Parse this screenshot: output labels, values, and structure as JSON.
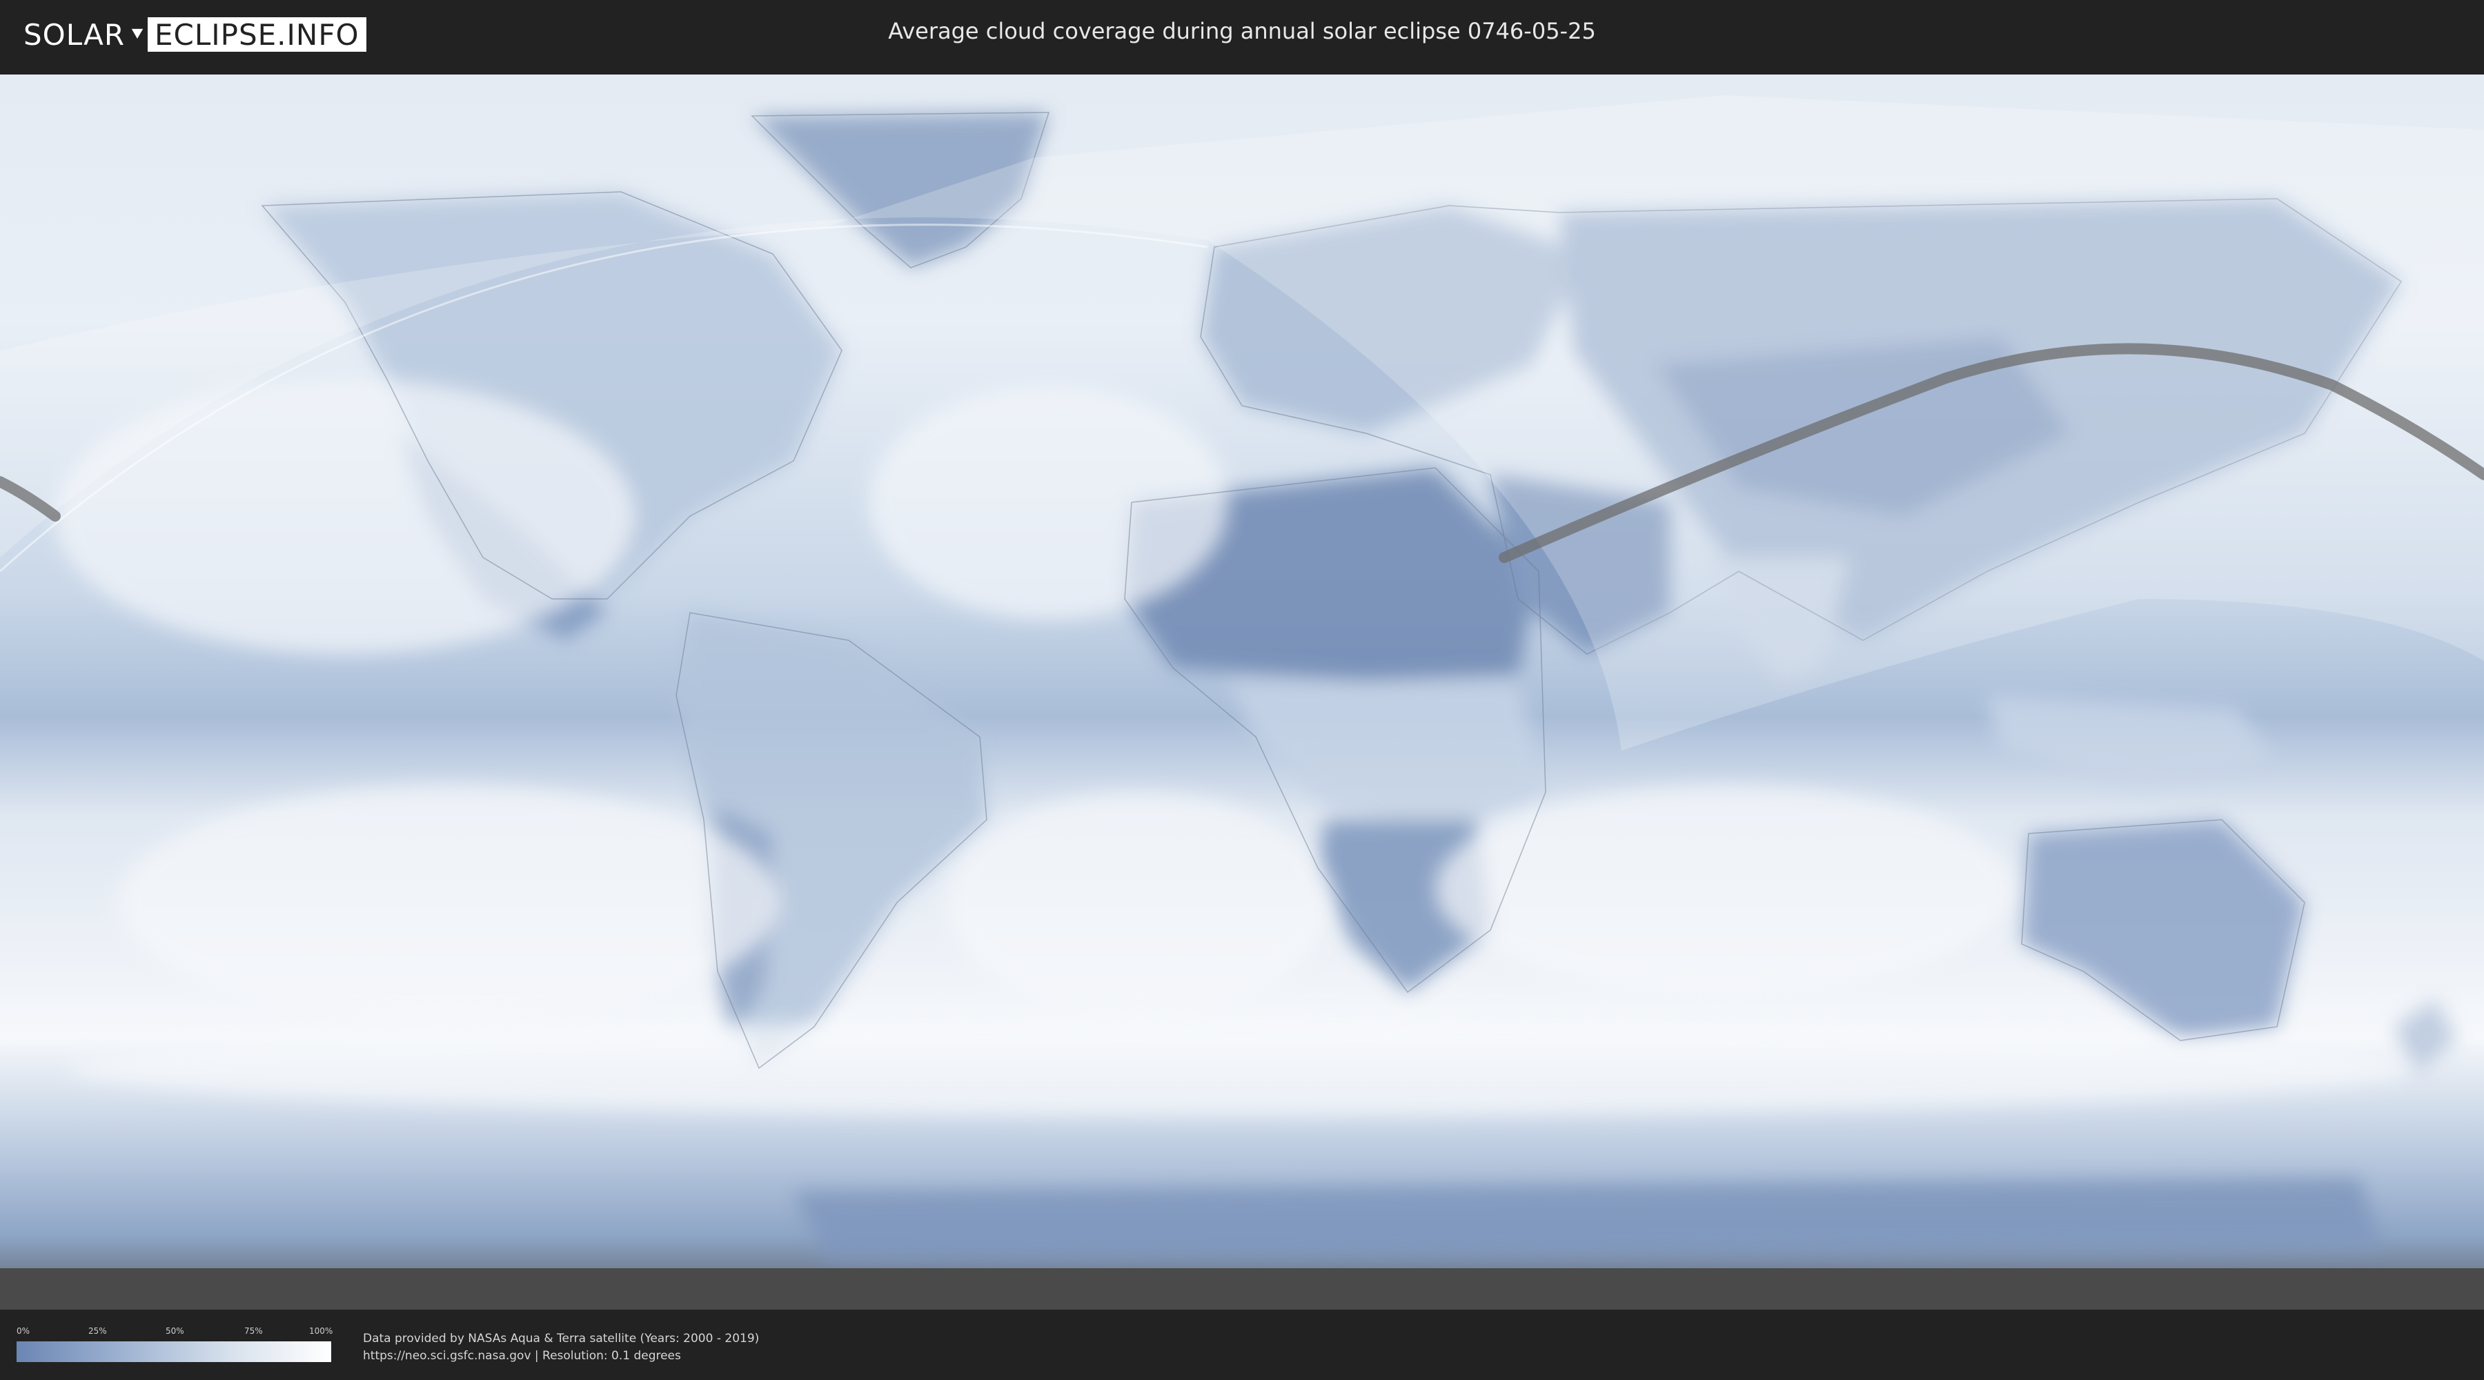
{
  "header": {
    "logo_left": "SOLAR",
    "logo_right": "ECLIPSE.INFO",
    "title": "Average cloud coverage during annual solar eclipse 0746-05-25"
  },
  "legend": {
    "ticks": [
      "0%",
      "25%",
      "50%",
      "75%",
      "100%"
    ],
    "gradient_colors": [
      "#6a86b3",
      "#9db2d1",
      "#d6e0ec",
      "#ffffff"
    ]
  },
  "footer": {
    "credit_line_1": "Data provided by NASAs Aqua & Terra satellite (Years: 2000 - 2019)",
    "credit_line_2": "https://neo.sci.gsfc.nasa.gov | Resolution: 0.1 degrees"
  },
  "map": {
    "type": "equirectangular cloud coverage map",
    "eclipse_path_color": "#6d6d6d",
    "land_cloud_color": "#6b85b0",
    "ocean_clear_color": "#f4f7fb"
  }
}
